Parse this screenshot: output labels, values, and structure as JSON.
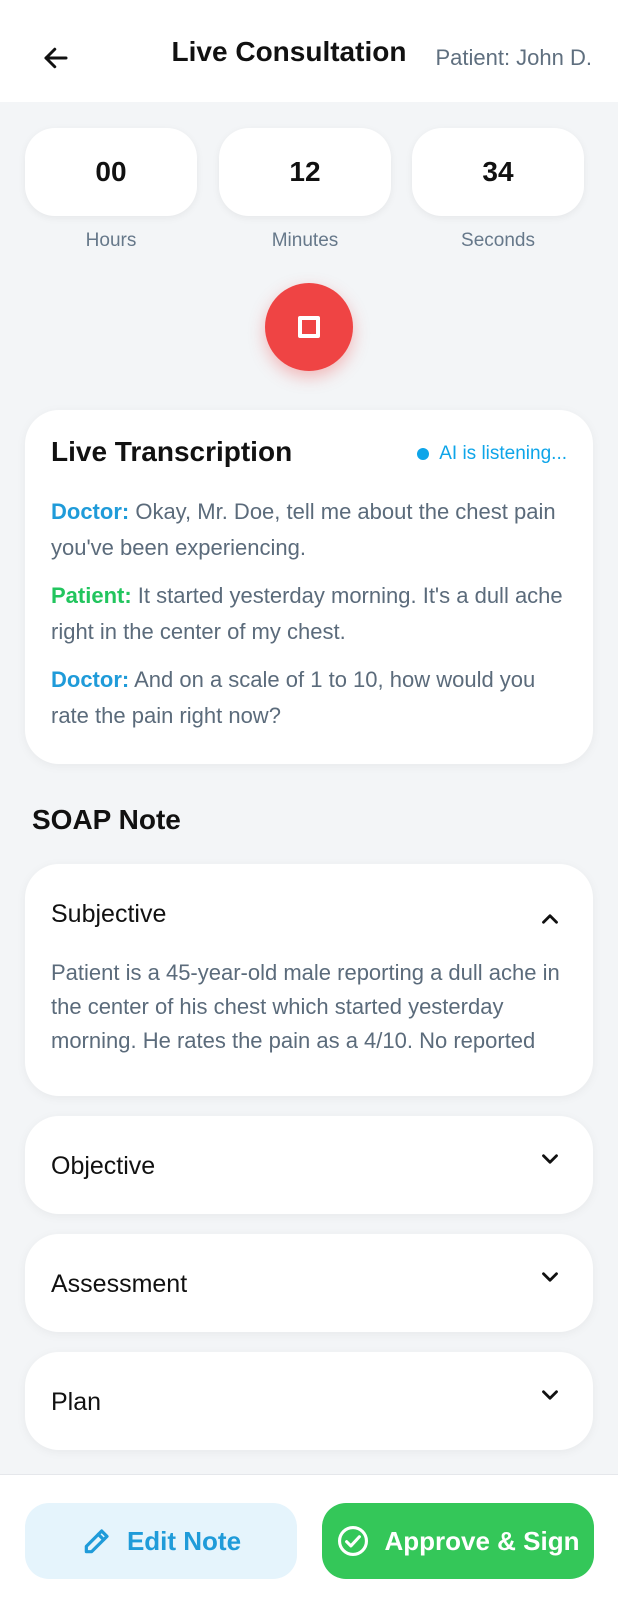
{
  "header": {
    "title": "Live Consultation",
    "patient": "Patient: John D."
  },
  "timer": {
    "hours": "00",
    "minutes": "12",
    "seconds": "34",
    "hours_label": "Hours",
    "minutes_label": "Minutes",
    "seconds_label": "Seconds"
  },
  "transcription": {
    "title": "Live Transcription",
    "status": "AI is listening...",
    "lines": [
      {
        "speaker": "Doctor:",
        "text": " Okay, Mr. Doe, tell me about the chest pain you've been experiencing."
      },
      {
        "speaker": "Patient:",
        "text": " It started yesterday morning. It's a dull ache right in the center of my chest."
      },
      {
        "speaker": "Doctor:",
        "text": " And on a scale of 1 to 10, how would you rate the pain right now?"
      }
    ]
  },
  "soap": {
    "heading": "SOAP Note",
    "sections": [
      {
        "title": "Subjective",
        "expanded": true,
        "body": "Patient is a 45-year-old male reporting a dull ache in the center of his chest which started yesterday morning. He rates the pain as a 4/10. No reported shortness of breath."
      },
      {
        "title": "Objective",
        "expanded": false
      },
      {
        "title": "Assessment",
        "expanded": false
      },
      {
        "title": "Plan",
        "expanded": false
      }
    ]
  },
  "footer": {
    "edit_label": "Edit Note",
    "approve_label": "Approve & Sign"
  },
  "colors": {
    "accent_blue": "#1f9bd9",
    "patient_green": "#22c55e",
    "stop_red": "#ef4444",
    "approve_green": "#34c759"
  },
  "icons": [
    "arrow-left-icon",
    "stop-icon",
    "listening-dot-icon",
    "chevron-up-icon",
    "chevron-down-icon",
    "pencil-icon",
    "check-circle-icon"
  ]
}
